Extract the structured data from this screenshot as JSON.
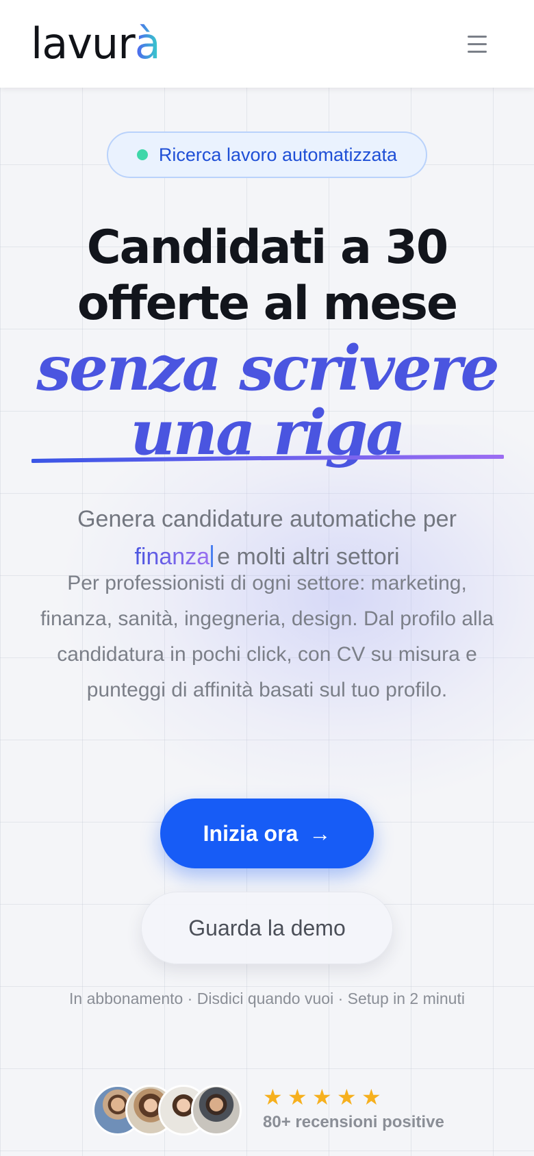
{
  "header": {
    "logo_main": "lavur",
    "logo_accent": "à",
    "menu_icon": "hamburger-menu-icon"
  },
  "badge": {
    "text": "Ricerca lavoro automatizzata",
    "dot_color": "#3fd7a9"
  },
  "hero": {
    "title_line1": "Candidati a 30",
    "title_line2": "offerte al mese",
    "italic_line1": "senza scrivere",
    "italic_line2": "una riga",
    "subtitle_line1": "Genera candidature automatiche per",
    "rotating_word": "finanza",
    "subtitle_line2_rest": "e molti altri settori",
    "description": "Per professionisti di ogni settore: marketing, finanza, sanità, ingegneria, design. Dal profilo alla candidatura in pochi click, con CV su misura e punteggi di affinità basati sul tuo profilo."
  },
  "cta": {
    "primary_label": "Inizia ora",
    "primary_arrow": "→",
    "secondary_label": "Guarda la demo",
    "note": "In abbonamento · Disdici quando vuoi · Setup in 2 minuti"
  },
  "social_proof": {
    "rating_stars": 5,
    "star_glyph": "★",
    "reviews_text": "80+ recensioni positive",
    "avatar_count": 4
  },
  "colors": {
    "primary": "#175cf6",
    "accent_italic": "#4a55e0",
    "star": "#f6b01e"
  }
}
